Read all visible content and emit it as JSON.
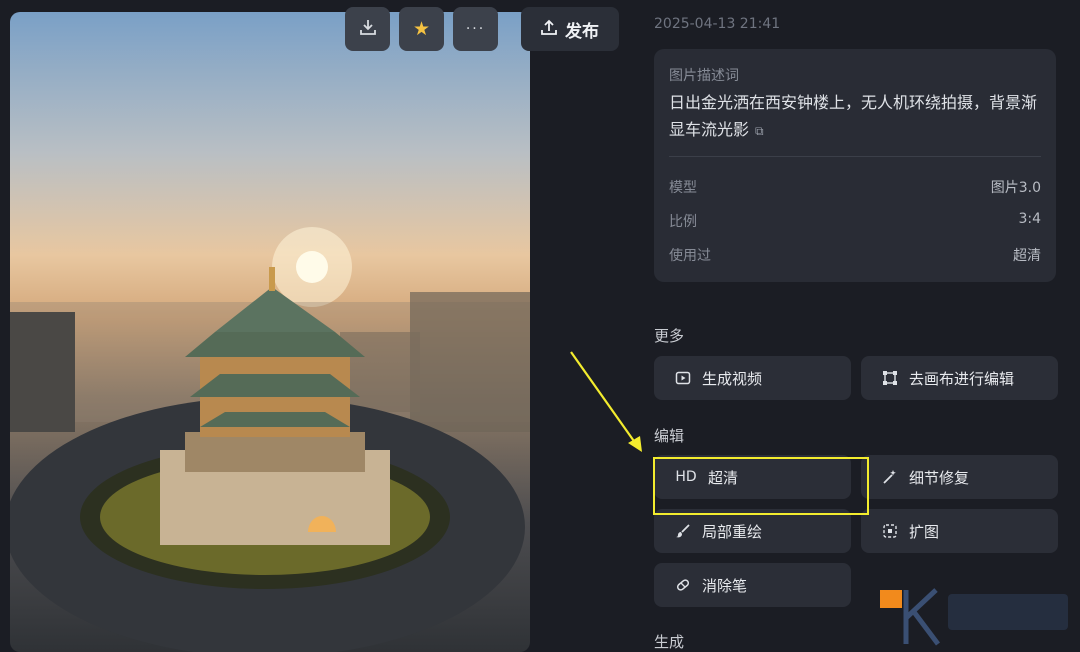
{
  "toolbar": {
    "download_icon": "download-icon",
    "favorite_icon": "star-icon",
    "more_icon": "more-icon",
    "publish_label": "发布"
  },
  "details": {
    "timestamp": "2025-04-13 21:41",
    "description_label": "图片描述词",
    "description_text": "日出金光洒在西安钟楼上，无人机环绕拍摄，背景渐显车流光影",
    "meta": [
      {
        "key": "模型",
        "value": "图片3.0"
      },
      {
        "key": "比例",
        "value": "3:4"
      },
      {
        "key": "使用过",
        "value": "超清"
      }
    ]
  },
  "sections": {
    "more_title": "更多",
    "edit_title": "编辑",
    "generate_title": "生成"
  },
  "more_actions": [
    {
      "label": "生成视频",
      "icon": "video-icon"
    },
    {
      "label": "去画布进行编辑",
      "icon": "canvas-icon"
    }
  ],
  "edit_actions": [
    {
      "label": "超清",
      "icon_text": "HD"
    },
    {
      "label": "细节修复",
      "icon": "magic-wand-icon"
    },
    {
      "label": "局部重绘",
      "icon": "brush-icon"
    },
    {
      "label": "扩图",
      "icon": "expand-icon"
    },
    {
      "label": "消除笔",
      "icon": "eraser-icon"
    }
  ],
  "colors": {
    "background": "#1b1d24",
    "card": "#292c35",
    "button": "#2b2e37",
    "highlight": "#f3ec2e",
    "star": "#f5c242"
  }
}
